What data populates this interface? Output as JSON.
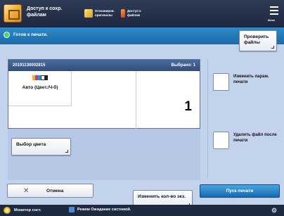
{
  "header": {
    "title": "Доступ к сохр. файлам",
    "scanned_label": "Отсканиров. оригиналы",
    "access_label": "Доступ к файлам",
    "menu_label": "Меню"
  },
  "status": {
    "text": "Готов к печати.",
    "check_button": "Проверить файлы"
  },
  "job": {
    "id": "20191130002815",
    "selected": "Выбрано: 1",
    "color_mode": "Авто (Цвет./Ч-б)",
    "copies": "1"
  },
  "buttons": {
    "select": "Выбор цвета",
    "combine": "Изменить кол-во экз.",
    "change_params": "Изменить парам. печати",
    "delete_after": "Удалить файл после печати",
    "cancel": "Отмена",
    "start": "Пуск печати"
  },
  "footer": {
    "monitor": "Монитор сост.",
    "message": "Режим Ожидание системой."
  },
  "colors": {
    "accent": "#1b6aa9",
    "panel": "#c3d3ec",
    "header": "#2f4c7d"
  }
}
